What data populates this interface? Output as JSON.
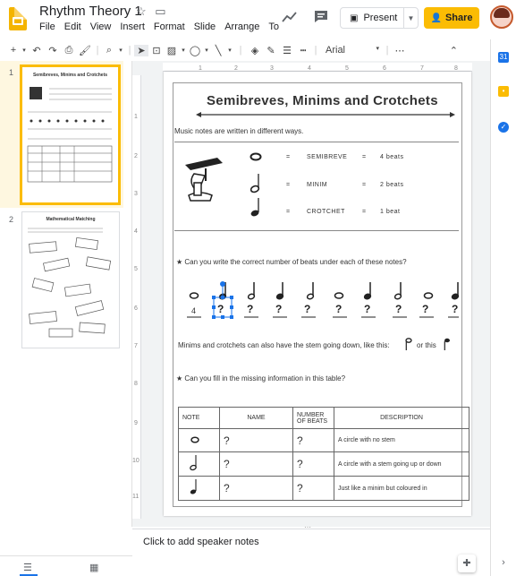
{
  "app": {
    "doc_title": "Rhythm Theory 1",
    "menu": [
      "File",
      "Edit",
      "View",
      "Insert",
      "Format",
      "Slide",
      "Arrange",
      "To"
    ],
    "present_label": "Present",
    "share_label": "Share",
    "font_name": "Arial"
  },
  "filmstrip": {
    "slide_numbers": [
      "1",
      "2"
    ],
    "thumb1_title": "Semibreves, Minims and Crotchets",
    "thumb2_title": "Mathematical Matching"
  },
  "slide": {
    "title": "Semibreves, Minims and Crotchets",
    "intro": "Music notes are written in different ways.",
    "notes": [
      {
        "name": "SEMIBREVE",
        "beats": "4 beats"
      },
      {
        "name": "MINIM",
        "beats": "2 beats"
      },
      {
        "name": "CROTCHET",
        "beats": "1 beat"
      }
    ],
    "eq": "=",
    "question1": "Can you write the correct number of beats under each of these notes?",
    "answers": [
      "4",
      "?",
      "?",
      "?",
      "?",
      "?",
      "?",
      "?",
      "?",
      "?"
    ],
    "stem_text": "Minims and crotchets can also have the stem going down, like this:",
    "stem_or": "or this",
    "question2": "Can you fill in the missing information in this table?",
    "table": {
      "headers": [
        "NOTE",
        "NAME",
        "NUMBER OF BEATS",
        "DESCRIPTION"
      ],
      "rows": [
        {
          "name": "?",
          "beats": "?",
          "desc": "A circle with no stem"
        },
        {
          "name": "?",
          "beats": "?",
          "desc": "A circle with a stem going up or down"
        },
        {
          "name": "?",
          "beats": "?",
          "desc": "Just like a minim but coloured in"
        }
      ]
    }
  },
  "speaker_notes": {
    "placeholder": "Click to add speaker notes"
  },
  "colors": {
    "accent": "#fbbc04",
    "selection": "#1a73e8"
  }
}
